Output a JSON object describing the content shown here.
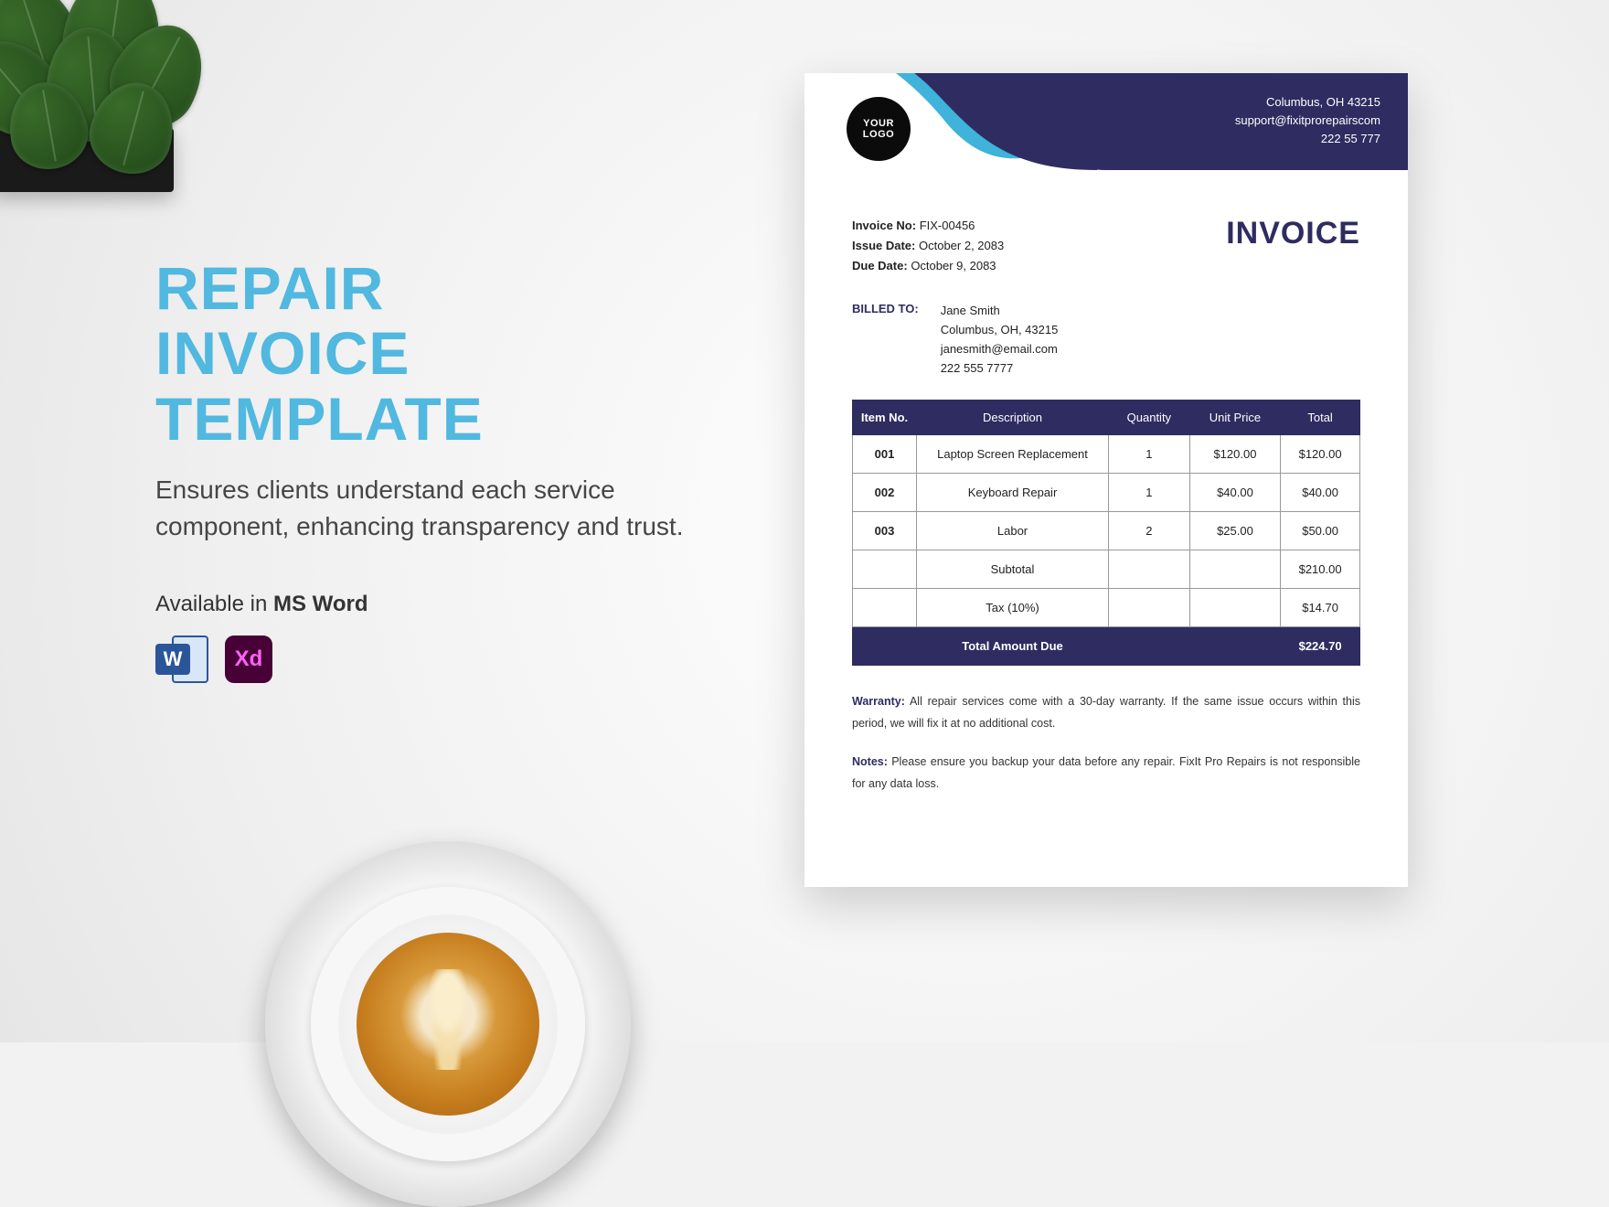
{
  "promo": {
    "title_line1": "REPAIR",
    "title_line2": "INVOICE",
    "title_line3": "TEMPLATE",
    "subtitle": "Ensures clients understand each service component, enhancing transparency and trust.",
    "available_prefix": "Available in ",
    "available_format": "MS Word",
    "word_letter": "W",
    "xd_label": "Xd"
  },
  "logo": {
    "line1": "YOUR",
    "line2": "LOGO"
  },
  "company": {
    "city": "Columbus, OH 43215",
    "email": "support@fixitprorepairscom",
    "phone": "222 55 777"
  },
  "invoice_heading": "INVOICE",
  "meta": {
    "invoice_no_label": "Invoice No:",
    "invoice_no": "FIX-00456",
    "issue_label": "Issue Date:",
    "issue_date": "October 2, 2083",
    "due_label": "Due Date:",
    "due_date": "October 9, 2083"
  },
  "billed": {
    "label": "BILLED TO:",
    "name": "Jane Smith",
    "address": "Columbus, OH, 43215",
    "email": "janesmith@email.com",
    "phone": "222 555 7777"
  },
  "table": {
    "headers": {
      "item": "Item No.",
      "desc": "Description",
      "qty": "Quantity",
      "price": "Unit Price",
      "total": "Total"
    },
    "rows": [
      {
        "item": "001",
        "desc": "Laptop Screen Replacement",
        "qty": "1",
        "price": "$120.00",
        "total": "$120.00"
      },
      {
        "item": "002",
        "desc": "Keyboard Repair",
        "qty": "1",
        "price": "$40.00",
        "total": "$40.00"
      },
      {
        "item": "003",
        "desc": "Labor",
        "qty": "2",
        "price": "$25.00",
        "total": "$50.00"
      }
    ],
    "subtotal_label": "Subtotal",
    "subtotal": "$210.00",
    "tax_label": "Tax (10%)",
    "tax": "$14.70",
    "total_label": "Total Amount Due",
    "total": "$224.70"
  },
  "warranty": {
    "label": "Warranty:",
    "text": " All repair services come with a 30-day warranty. If the same issue occurs within this period, we will fix it at no additional cost."
  },
  "notes": {
    "label": "Notes:",
    "text": " Please ensure you backup your data before any repair. FixIt Pro Repairs is not responsible for any data loss."
  }
}
